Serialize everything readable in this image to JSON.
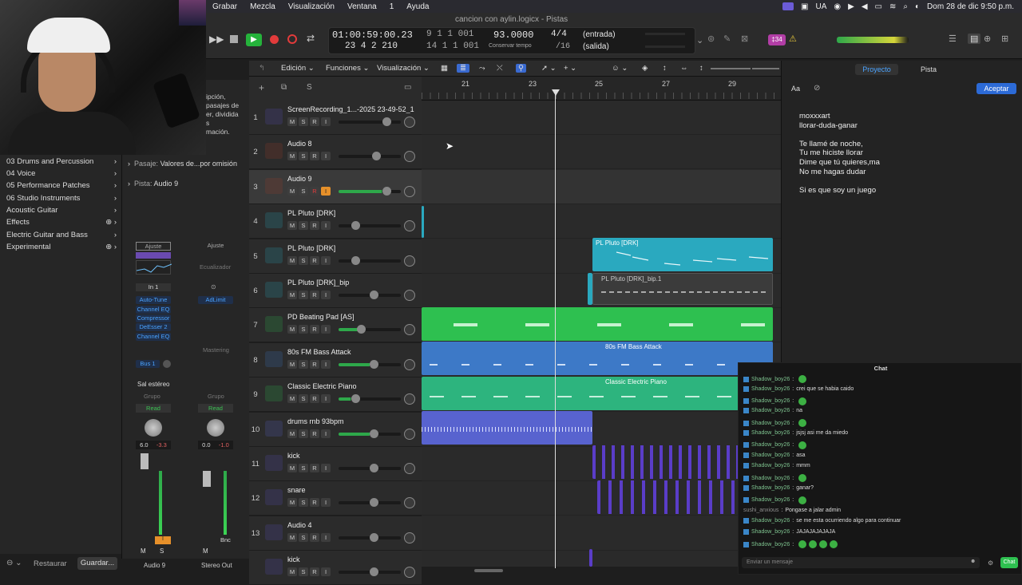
{
  "menubar": {
    "items": [
      "Grabar",
      "Mezcla",
      "Visualización",
      "Ventana",
      "1",
      "Ayuda"
    ],
    "lang": "UA",
    "datetime": "Dom 28 de dic 9:50 p.m."
  },
  "window": {
    "title": "cancion con aylin.logicx - Pistas"
  },
  "transport": {
    "time": "01:00:59:00.23",
    "bars_top": "9 1 1 001",
    "bars_bottom_a": "23 4 2 210",
    "bars_bottom_b": "14 1 1 001",
    "tempo": "93.0000",
    "tempo_label": "Conservar tempo",
    "sig": "4/4",
    "div": "/16",
    "in_label": "(entrada)",
    "out_label": "(salida)",
    "badge": "‡34"
  },
  "toolbar": {
    "edit": "Edición",
    "functions": "Funciones",
    "view": "Visualización"
  },
  "ruler": {
    "bars": [
      "21",
      "23",
      "25",
      "27",
      "29"
    ]
  },
  "library": {
    "peek": [
      "ipción,",
      "pasajes de",
      "er, dividida",
      "s",
      "mación."
    ],
    "items": [
      "03 Drums and Percussion",
      "04 Voice",
      "05 Performance Patches",
      "06 Studio Instruments",
      "Acoustic Guitar",
      "Effects",
      "Electric Guitar and Bass",
      "Experimental"
    ]
  },
  "inspector": {
    "region_label": "Pasaje:",
    "region_value": "Valores de...por omisión",
    "track_label": "Pista:",
    "track_value": "Audio 9",
    "setting_a": "Ajuste",
    "setting_b": "Ajuste",
    "eq_label": "Ecualizador",
    "input": "In 1",
    "plugins": [
      "Auto-Tune",
      "Channel EQ",
      "Compressor",
      "DeEsser 2",
      "Channel EQ"
    ],
    "plugin_b": "AdLimit",
    "send": "Bus 1",
    "mastering": "Mastering",
    "output": "Sal estéreo",
    "group_a": "Grupo",
    "group_b": "Grupo",
    "read_a": "Read",
    "read_b": "Read",
    "vol_a": "6.0",
    "vol_a2": "-3.3",
    "vol_b": "0.0",
    "vol_b2": "-1.0",
    "bnc": "Bnc",
    "m": "M",
    "s": "S",
    "channel_a": "Audio 9",
    "channel_b": "Stereo Out"
  },
  "bottombar": {
    "restore": "Restaurar",
    "save": "Guardar..."
  },
  "tracks": [
    {
      "num": "1",
      "name": "ScreenRecording_1...-2025 23-49-52_1",
      "type": "audio"
    },
    {
      "num": "2",
      "name": "Audio 8",
      "type": "audio-red"
    },
    {
      "num": "3",
      "name": "Audio 9",
      "type": "audio-red"
    },
    {
      "num": "4",
      "name": "PL Pluto [DRK]",
      "type": "inst"
    },
    {
      "num": "5",
      "name": "PL Pluto [DRK]",
      "type": "inst"
    },
    {
      "num": "6",
      "name": "PL Pluto [DRK]_bip",
      "type": "inst"
    },
    {
      "num": "7",
      "name": "PD Beating Pad [AS]",
      "type": "inst-green"
    },
    {
      "num": "8",
      "name": "80s FM Bass Attack",
      "type": "synth"
    },
    {
      "num": "9",
      "name": "Classic Electric Piano",
      "type": "inst-green"
    },
    {
      "num": "10",
      "name": "drums rnb 93bpm",
      "type": "drums"
    },
    {
      "num": "11",
      "name": "kick",
      "type": "audio"
    },
    {
      "num": "12",
      "name": "snare",
      "type": "audio"
    },
    {
      "num": "13",
      "name": "Audio 4",
      "type": "audio"
    },
    {
      "num": "",
      "name": "kick",
      "type": "audio"
    }
  ],
  "regions": {
    "pluto5": "PL Pluto [DRK]",
    "pluto6": "PL Pluto [DRK]_bip.1",
    "fm": "80s FM Bass Attack",
    "ep": "Classic Electric Piano"
  },
  "notepad": {
    "tab_project": "Proyecto",
    "tab_track": "Pista",
    "accept": "Aceptar",
    "font_btn": "Aa",
    "lines": [
      "moxxxart",
      "llorar-duda-ganar",
      "",
      "Te llamé de noche,",
      "Tu me hiciste llorar",
      "Dime que tú quieres,ma",
      "No me hagas dudar",
      "",
      "Si es que soy un juego"
    ]
  },
  "chat": {
    "title": "Chat",
    "messages": [
      {
        "user": "Shadow_boy26",
        "text": "",
        "emotes": 1
      },
      {
        "user": "Shadow_boy26",
        "text": "crei que se habia caido",
        "emotes": 0
      },
      {
        "user": "Shadow_boy26",
        "text": "",
        "emotes": 1
      },
      {
        "user": "Shadow_boy26",
        "text": "na",
        "emotes": 0
      },
      {
        "user": "Shadow_boy26",
        "text": "",
        "emotes": 1
      },
      {
        "user": "Shadow_boy26",
        "text": "jsjsj asi me da miedo",
        "emotes": 0
      },
      {
        "user": "Shadow_boy26",
        "text": "",
        "emotes": 1
      },
      {
        "user": "Shadow_boy26",
        "text": "asa",
        "emotes": 0
      },
      {
        "user": "Shadow_boy26",
        "text": "mmm",
        "emotes": 0
      },
      {
        "user": "Shadow_boy26",
        "text": "",
        "emotes": 1
      },
      {
        "user": "Shadow_boy26",
        "text": "ganar?",
        "emotes": 0
      },
      {
        "user": "Shadow_boy26",
        "text": "",
        "emotes": 1
      },
      {
        "user": "sushi_anxious",
        "text": "Pongase a jalar admin",
        "emotes": 0
      },
      {
        "user": "Shadow_boy26",
        "text": "se me esta ocurriendo algo para continuar",
        "emotes": 0
      },
      {
        "user": "Shadow_boy26",
        "text": "JAJAJAJAJAJA",
        "emotes": 0
      },
      {
        "user": "Shadow_boy26",
        "text": "",
        "emotes": 4
      }
    ],
    "placeholder": "Enviar un mensaje",
    "send": "Chat"
  }
}
